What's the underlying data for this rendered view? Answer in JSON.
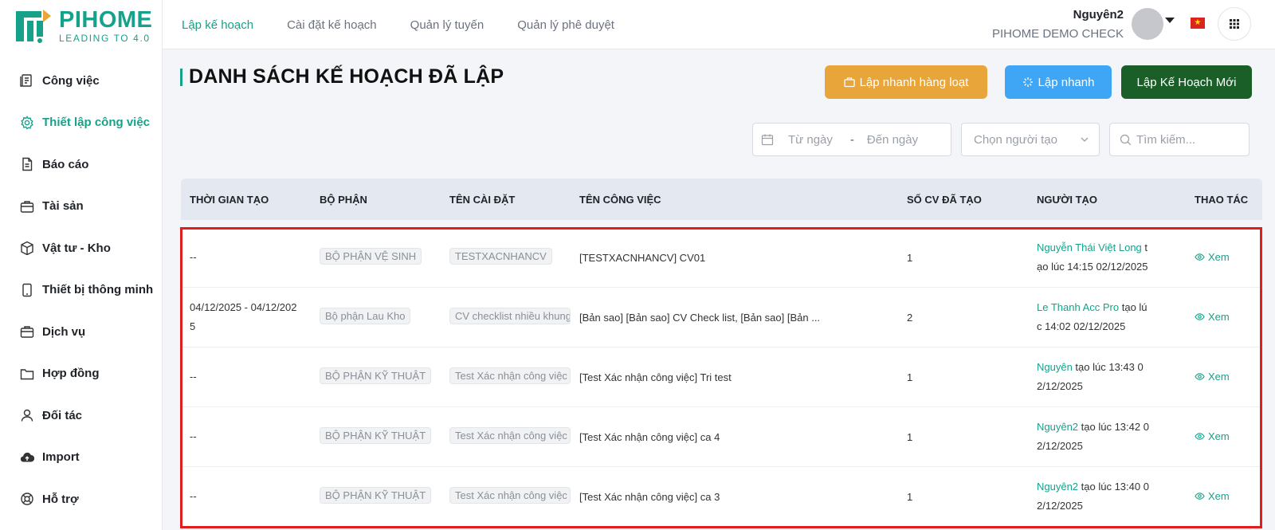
{
  "brand": {
    "name": "PIHOME",
    "tagline": "LEADING TO 4.0"
  },
  "colors": {
    "accent": "#16a28a",
    "bulk_button": "#e8a53a",
    "quick_button": "#3ea6f5",
    "new_button": "#1a5e28",
    "highlight": "#e01e1e"
  },
  "sidebar": {
    "items": [
      {
        "label": "Công việc",
        "icon": "document-icon"
      },
      {
        "label": "Thiết lập công việc",
        "icon": "gear-icon",
        "active": true
      },
      {
        "label": "Báo cáo",
        "icon": "report-icon"
      },
      {
        "label": "Tài sản",
        "icon": "briefcase-icon"
      },
      {
        "label": "Vật tư - Kho",
        "icon": "box-icon"
      },
      {
        "label": "Thiết bị thông minh",
        "icon": "tablet-icon"
      },
      {
        "label": "Dịch vụ",
        "icon": "briefcase-icon"
      },
      {
        "label": "Hợp đồng",
        "icon": "folder-icon"
      },
      {
        "label": "Đối tác",
        "icon": "person-icon"
      },
      {
        "label": "Import",
        "icon": "cloud-upload-icon"
      },
      {
        "label": "Hỗ trợ",
        "icon": "lifebuoy-icon"
      }
    ]
  },
  "header": {
    "tabs": [
      {
        "label": "Lập kế hoạch",
        "active": true
      },
      {
        "label": "Cài đặt kế hoạch"
      },
      {
        "label": "Quản lý tuyến"
      },
      {
        "label": "Quản lý phê duyệt"
      }
    ],
    "user_name": "Nguyên2",
    "org_name": "PIHOME DEMO CHECK"
  },
  "main": {
    "title": "DANH SÁCH KẾ HOẠCH ĐÃ LẬP",
    "buttons": {
      "bulk": "Lập nhanh hàng loạt",
      "quick": "Lập nhanh",
      "new": "Lập Kế Hoạch Mới"
    },
    "filters": {
      "from_placeholder": "Từ ngày",
      "separator": "-",
      "to_placeholder": "Đến ngày",
      "creator_placeholder": "Chọn người tạo",
      "search_placeholder": "Tìm kiếm..."
    },
    "table": {
      "headers": [
        "THỜI GIAN TẠO",
        "BỘ PHẬN",
        "TÊN CÀI ĐẶT",
        "TÊN CÔNG VIỆC",
        "SỐ CV ĐÃ TẠO",
        "NGƯỜI TẠO",
        "THAO TÁC"
      ],
      "rows": [
        {
          "time_line1": "--",
          "time_line2": "",
          "dept": "BỘ PHẬN VỆ SINH",
          "setting": "TESTXACNHANCV",
          "job": "[TESTXACNHANCV] CV01",
          "count": "1",
          "creator": "Nguyễn Thái Việt Long",
          "creator_rest1": " t",
          "creator_rest2": "ạo lúc 14:15 02/12/2025",
          "action": "Xem"
        },
        {
          "time_line1": "04/12/2025 - 04/12/202",
          "time_line2": "5",
          "dept": "Bộ phận Lau Kho",
          "setting": "CV checklist nhiều khung",
          "job": "[Bản sao] [Bản sao] CV Check list, [Bản sao] [Bản ...",
          "count": "2",
          "creator": "Le Thanh Acc Pro",
          "creator_rest1": " tạo lú",
          "creator_rest2": "c 14:02 02/12/2025",
          "action": "Xem"
        },
        {
          "time_line1": "--",
          "time_line2": "",
          "dept": "BỘ PHẬN KỸ THUẬT",
          "setting": "Test Xác nhận công việc",
          "job": "[Test Xác nhận công việc] Tri test",
          "count": "1",
          "creator": "Nguyên",
          "creator_rest1": " tạo lúc 13:43 0",
          "creator_rest2": "2/12/2025",
          "action": "Xem"
        },
        {
          "time_line1": "--",
          "time_line2": "",
          "dept": "BỘ PHẬN KỸ THUẬT",
          "setting": "Test Xác nhận công việc",
          "job": "[Test Xác nhận công việc] ca 4",
          "count": "1",
          "creator": "Nguyên2",
          "creator_rest1": " tạo lúc 13:42 0",
          "creator_rest2": "2/12/2025",
          "action": "Xem"
        },
        {
          "time_line1": "--",
          "time_line2": "",
          "dept": "BỘ PHẬN KỸ THUẬT",
          "setting": "Test Xác nhận công việc",
          "job": "[Test Xác nhận công việc] ca 3",
          "count": "1",
          "creator": "Nguyên2",
          "creator_rest1": " tạo lúc 13:40 0",
          "creator_rest2": "2/12/2025",
          "action": "Xem"
        }
      ]
    }
  }
}
